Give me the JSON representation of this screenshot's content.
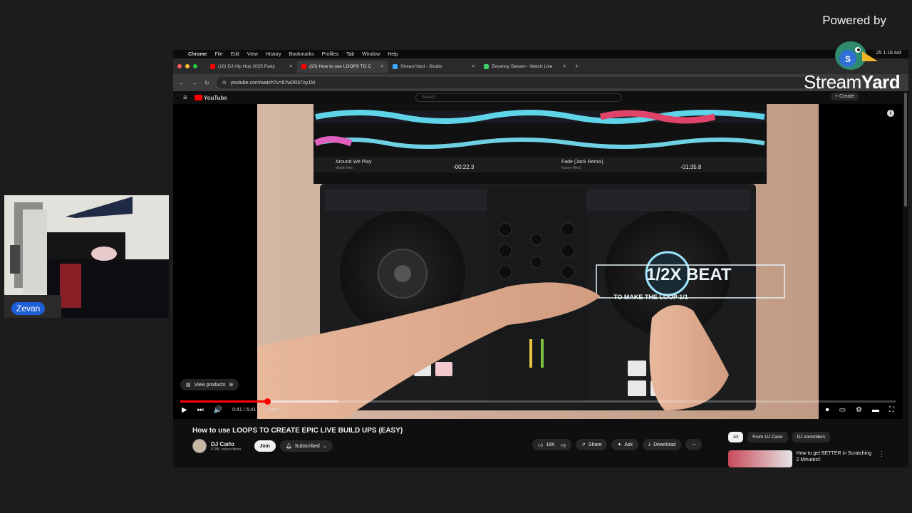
{
  "branding": {
    "powered_by": "Powered by",
    "wordmark_part1": "Stream",
    "wordmark_part2": "Yard"
  },
  "webcam": {
    "participant_name": "Zevan"
  },
  "mac_menubar": {
    "items": [
      "Chrome",
      "File",
      "Edit",
      "View",
      "History",
      "Bookmarks",
      "Profiles",
      "Tab",
      "Window",
      "Help"
    ],
    "clock": "25 1:18 AM"
  },
  "browser": {
    "tabs": [
      {
        "label": "(10) DJ Hip Hop 2025 Party",
        "color": "#ff0000"
      },
      {
        "label": "(10) How to use LOOPS TO C",
        "color": "#ff0000",
        "active": true
      },
      {
        "label": "StreamYard - Studio",
        "color": "#3ea6ff"
      },
      {
        "label": "Zevanuy Stream - Watch Live",
        "color": "#3fd46a"
      }
    ],
    "url": "youtube.com/watch?v=67w0R37oy1M"
  },
  "youtube": {
    "logo_text": "YouTube",
    "search_placeholder": "Search",
    "create_label": "+ Create",
    "video": {
      "deck_a_track": "Around We Play",
      "deck_a_artist": "Wasle Res",
      "deck_a_time": "-00:22.3",
      "deck_b_track": "Fade (Jack Remix)",
      "deck_b_artist": "Kanye West",
      "deck_b_time": "-01:35.8",
      "overlay_title": "1/2X BEAT",
      "overlay_sub": "TO MAKE THE LOOP 1/1",
      "view_products": "View products",
      "time": "0:41 / 5:41",
      "chapter": "• Intro ›",
      "progress": 0.122
    },
    "title": "How to use LOOPS TO CREATE EPIC LIVE BUILD UPS (EASY)",
    "channel": "DJ Carlo",
    "subscribers": "678K subscribers",
    "join_label": "Join",
    "subscribed_label": "Subscribed",
    "likes": "16K",
    "share_label": "Share",
    "ask_label": "Ask",
    "download_label": "Download",
    "chips": [
      "All",
      "From DJ Carlo",
      "DJ controllers"
    ],
    "recommended_title": "How to get BETTER in Scratching 2 Minutes!!"
  }
}
